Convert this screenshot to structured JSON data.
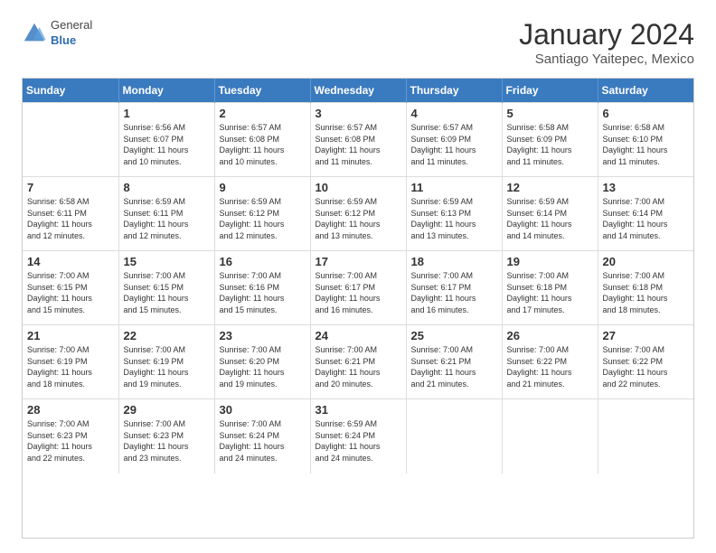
{
  "logo": {
    "general": "General",
    "blue": "Blue"
  },
  "title": "January 2024",
  "subtitle": "Santiago Yaitepec, Mexico",
  "days": [
    "Sunday",
    "Monday",
    "Tuesday",
    "Wednesday",
    "Thursday",
    "Friday",
    "Saturday"
  ],
  "weeks": [
    [
      {
        "num": "",
        "info": ""
      },
      {
        "num": "1",
        "info": "Sunrise: 6:56 AM\nSunset: 6:07 PM\nDaylight: 11 hours\nand 10 minutes."
      },
      {
        "num": "2",
        "info": "Sunrise: 6:57 AM\nSunset: 6:08 PM\nDaylight: 11 hours\nand 10 minutes."
      },
      {
        "num": "3",
        "info": "Sunrise: 6:57 AM\nSunset: 6:08 PM\nDaylight: 11 hours\nand 11 minutes."
      },
      {
        "num": "4",
        "info": "Sunrise: 6:57 AM\nSunset: 6:09 PM\nDaylight: 11 hours\nand 11 minutes."
      },
      {
        "num": "5",
        "info": "Sunrise: 6:58 AM\nSunset: 6:09 PM\nDaylight: 11 hours\nand 11 minutes."
      },
      {
        "num": "6",
        "info": "Sunrise: 6:58 AM\nSunset: 6:10 PM\nDaylight: 11 hours\nand 11 minutes."
      }
    ],
    [
      {
        "num": "7",
        "info": "Sunrise: 6:58 AM\nSunset: 6:11 PM\nDaylight: 11 hours\nand 12 minutes."
      },
      {
        "num": "8",
        "info": "Sunrise: 6:59 AM\nSunset: 6:11 PM\nDaylight: 11 hours\nand 12 minutes."
      },
      {
        "num": "9",
        "info": "Sunrise: 6:59 AM\nSunset: 6:12 PM\nDaylight: 11 hours\nand 12 minutes."
      },
      {
        "num": "10",
        "info": "Sunrise: 6:59 AM\nSunset: 6:12 PM\nDaylight: 11 hours\nand 13 minutes."
      },
      {
        "num": "11",
        "info": "Sunrise: 6:59 AM\nSunset: 6:13 PM\nDaylight: 11 hours\nand 13 minutes."
      },
      {
        "num": "12",
        "info": "Sunrise: 6:59 AM\nSunset: 6:14 PM\nDaylight: 11 hours\nand 14 minutes."
      },
      {
        "num": "13",
        "info": "Sunrise: 7:00 AM\nSunset: 6:14 PM\nDaylight: 11 hours\nand 14 minutes."
      }
    ],
    [
      {
        "num": "14",
        "info": "Sunrise: 7:00 AM\nSunset: 6:15 PM\nDaylight: 11 hours\nand 15 minutes."
      },
      {
        "num": "15",
        "info": "Sunrise: 7:00 AM\nSunset: 6:15 PM\nDaylight: 11 hours\nand 15 minutes."
      },
      {
        "num": "16",
        "info": "Sunrise: 7:00 AM\nSunset: 6:16 PM\nDaylight: 11 hours\nand 15 minutes."
      },
      {
        "num": "17",
        "info": "Sunrise: 7:00 AM\nSunset: 6:17 PM\nDaylight: 11 hours\nand 16 minutes."
      },
      {
        "num": "18",
        "info": "Sunrise: 7:00 AM\nSunset: 6:17 PM\nDaylight: 11 hours\nand 16 minutes."
      },
      {
        "num": "19",
        "info": "Sunrise: 7:00 AM\nSunset: 6:18 PM\nDaylight: 11 hours\nand 17 minutes."
      },
      {
        "num": "20",
        "info": "Sunrise: 7:00 AM\nSunset: 6:18 PM\nDaylight: 11 hours\nand 18 minutes."
      }
    ],
    [
      {
        "num": "21",
        "info": "Sunrise: 7:00 AM\nSunset: 6:19 PM\nDaylight: 11 hours\nand 18 minutes."
      },
      {
        "num": "22",
        "info": "Sunrise: 7:00 AM\nSunset: 6:19 PM\nDaylight: 11 hours\nand 19 minutes."
      },
      {
        "num": "23",
        "info": "Sunrise: 7:00 AM\nSunset: 6:20 PM\nDaylight: 11 hours\nand 19 minutes."
      },
      {
        "num": "24",
        "info": "Sunrise: 7:00 AM\nSunset: 6:21 PM\nDaylight: 11 hours\nand 20 minutes."
      },
      {
        "num": "25",
        "info": "Sunrise: 7:00 AM\nSunset: 6:21 PM\nDaylight: 11 hours\nand 21 minutes."
      },
      {
        "num": "26",
        "info": "Sunrise: 7:00 AM\nSunset: 6:22 PM\nDaylight: 11 hours\nand 21 minutes."
      },
      {
        "num": "27",
        "info": "Sunrise: 7:00 AM\nSunset: 6:22 PM\nDaylight: 11 hours\nand 22 minutes."
      }
    ],
    [
      {
        "num": "28",
        "info": "Sunrise: 7:00 AM\nSunset: 6:23 PM\nDaylight: 11 hours\nand 22 minutes."
      },
      {
        "num": "29",
        "info": "Sunrise: 7:00 AM\nSunset: 6:23 PM\nDaylight: 11 hours\nand 23 minutes."
      },
      {
        "num": "30",
        "info": "Sunrise: 7:00 AM\nSunset: 6:24 PM\nDaylight: 11 hours\nand 24 minutes."
      },
      {
        "num": "31",
        "info": "Sunrise: 6:59 AM\nSunset: 6:24 PM\nDaylight: 11 hours\nand 24 minutes."
      },
      {
        "num": "",
        "info": ""
      },
      {
        "num": "",
        "info": ""
      },
      {
        "num": "",
        "info": ""
      }
    ]
  ]
}
